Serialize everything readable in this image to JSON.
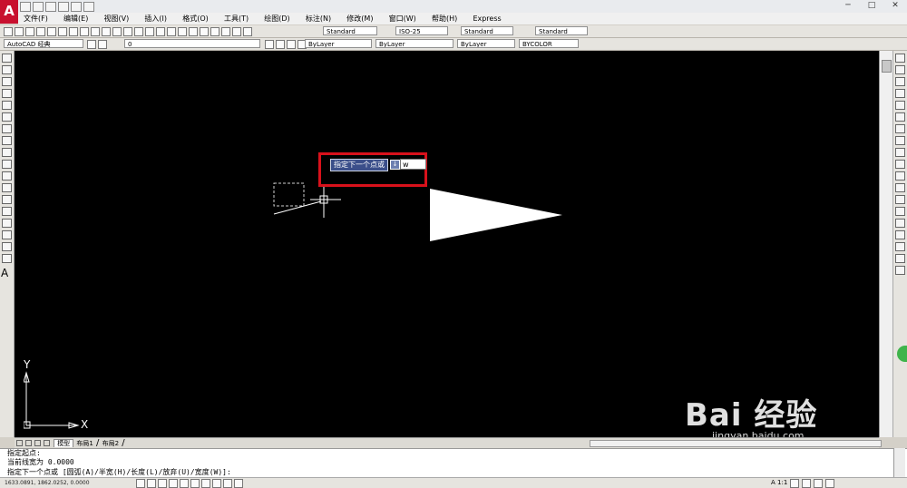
{
  "app": {
    "logo_letter": "A"
  },
  "window": {
    "min_glyph": "─",
    "max_glyph": "□",
    "close_glyph": "✕"
  },
  "menu": {
    "items": [
      "文件(F)",
      "编辑(E)",
      "视图(V)",
      "插入(I)",
      "格式(O)",
      "工具(T)",
      "绘图(D)",
      "标注(N)",
      "修改(M)",
      "窗口(W)",
      "帮助(H)",
      "Express"
    ]
  },
  "toolbar": {
    "text_style": "Standard",
    "dim_style": "ISO-25",
    "table_style": "Standard",
    "mleader_style": "Standard",
    "workspace": "AutoCAD 经典",
    "layer": "0",
    "color": "ByLayer",
    "linetype": "ByLayer",
    "lineweight": "ByLayer",
    "plotstyle": "BYCOLOR"
  },
  "tooltip": {
    "prompt": "指定下一个点或",
    "icon_glyph": "↓",
    "input_value": "w"
  },
  "ucs": {
    "y_label": "Y",
    "x_label": "X"
  },
  "layout_tabs": {
    "model": "模型",
    "layout1": "布局1",
    "layout2": "布局2"
  },
  "command_history": {
    "line1": "指定起点:",
    "line2": "当前线宽为 0.0000",
    "line3": "指定下一个点或 [圆弧(A)/半宽(H)/长度(L)/放弃(U)/宽度(W)]:"
  },
  "status": {
    "coords": "1633.0891, 1862.0252, 0.0000",
    "scale": "A 1:1"
  },
  "watermark": {
    "main": "Bai 经验",
    "url": "jingyan.baidu.com"
  },
  "colors": {
    "highlight_border": "#d8111b",
    "tooltip_bg": "#3b4f8a",
    "canvas_bg": "#000000"
  }
}
